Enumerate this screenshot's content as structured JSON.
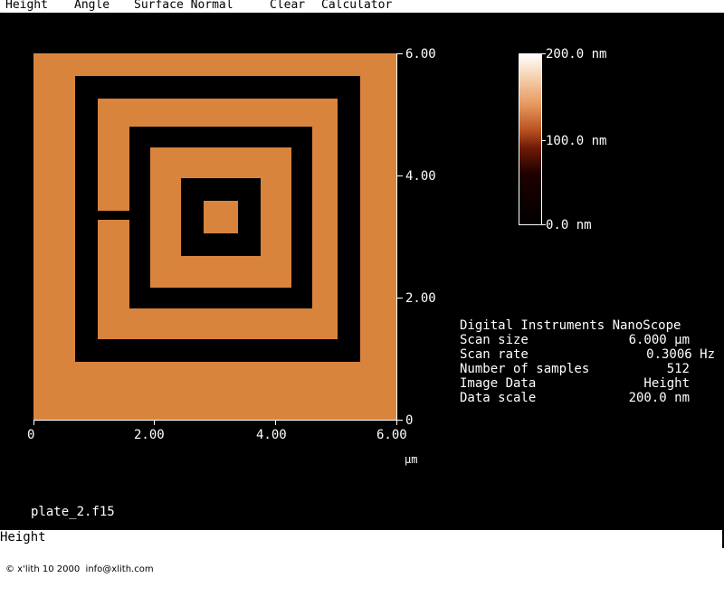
{
  "menu": {
    "items": [
      "Height",
      "Angle",
      "Surface Normal",
      "Clear",
      "Calculator"
    ]
  },
  "image": {
    "y_ticks": [
      "6.00",
      "4.00",
      "2.00",
      "0"
    ],
    "x_ticks": [
      "0",
      "2.00",
      "4.00",
      "6.00"
    ],
    "x_unit": "µm"
  },
  "colorbar": {
    "top": "200.0 nm",
    "mid": "100.0 nm",
    "bottom": "0.0 nm"
  },
  "info": {
    "title": "Digital Instruments NanoScope",
    "rows": [
      {
        "key": "Scan size",
        "value": "6.000 µm"
      },
      {
        "key": "Scan rate",
        "value": "0.3006 Hz"
      },
      {
        "key": "Number of samples",
        "value": "512"
      },
      {
        "key": "Image Data",
        "value": "Height"
      },
      {
        "key": "Data scale",
        "value": "200.0 nm"
      }
    ]
  },
  "filename": "plate_2.f15",
  "status": "Height",
  "copyright": "© x'lith 10 2000  info@xlith.com",
  "colors": {
    "sample": "#d9843d",
    "background": "#000000"
  }
}
